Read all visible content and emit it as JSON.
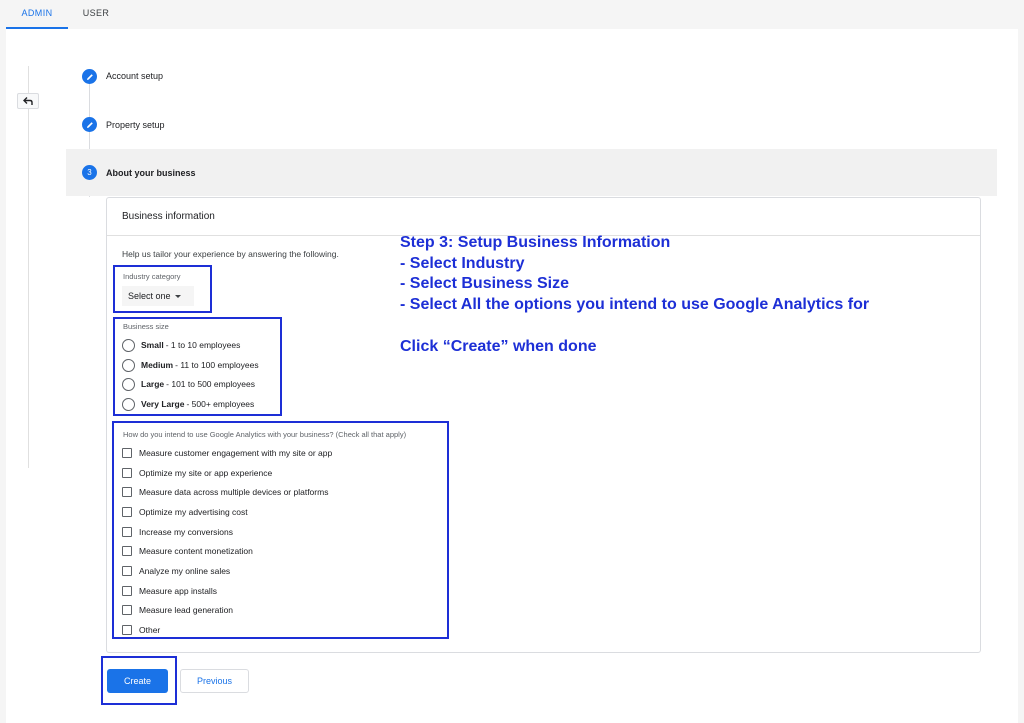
{
  "tabs": {
    "admin": "ADMIN",
    "user": "USER"
  },
  "stepper": {
    "step1": "Account setup",
    "step2": "Property setup",
    "step3_number": "3",
    "step3": "About your business"
  },
  "card": {
    "title": "Business information",
    "helper": "Help us tailor your experience by answering the following."
  },
  "industry": {
    "label": "Industry category",
    "value": "Select one"
  },
  "business_size": {
    "label": "Business size",
    "options": [
      {
        "name": "Small",
        "detail": "- 1 to 10 employees"
      },
      {
        "name": "Medium",
        "detail": "- 11 to 100 employees"
      },
      {
        "name": "Large",
        "detail": "- 101 to 500 employees"
      },
      {
        "name": "Very Large",
        "detail": "- 500+ employees"
      }
    ]
  },
  "usage": {
    "label": "How do you intend to use Google Analytics with your business? (Check all that apply)",
    "options": [
      "Measure customer engagement with my site or app",
      "Optimize my site or app experience",
      "Measure data across multiple devices or platforms",
      "Optimize my advertising cost",
      "Increase my conversions",
      "Measure content monetization",
      "Analyze my online sales",
      "Measure app installs",
      "Measure lead generation",
      "Other"
    ]
  },
  "annotation": {
    "line1": "Step 3: Setup Business Information",
    "line2": "- Select Industry",
    "line3": "- Select Business Size",
    "line4": "- Select All the options you intend to use Google Analytics for",
    "line5": "Click “Create” when done"
  },
  "buttons": {
    "create": "Create",
    "previous": "Previous"
  },
  "colors": {
    "accent": "#1a73e8",
    "annotation": "#1d2fd6"
  }
}
